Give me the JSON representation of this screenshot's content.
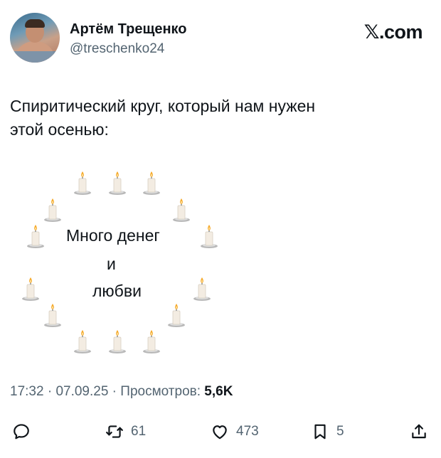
{
  "author": {
    "name": "Артём Трещенко",
    "handle": "@treschenko24"
  },
  "brand": {
    "x_glyph": "𝕏",
    "domain": ".com"
  },
  "tweet": {
    "line1": "Спиритический круг, который нам нужен",
    "line2": "этой осенью:"
  },
  "art_text": {
    "line1": "Много денег",
    "line2": "и",
    "line3": "любви"
  },
  "meta": {
    "time": "17:32",
    "sep1": " · ",
    "date": "07.09.25",
    "sep2": " · ",
    "views_label": "Просмотров: ",
    "views_value": "5,6K"
  },
  "actions": {
    "retweets": "61",
    "likes": "473",
    "bookmarks": "5"
  },
  "colors": {
    "text": "#0f1419",
    "secondary": "#536471",
    "flame": "#f5a623",
    "candle": "#f3ece2"
  }
}
